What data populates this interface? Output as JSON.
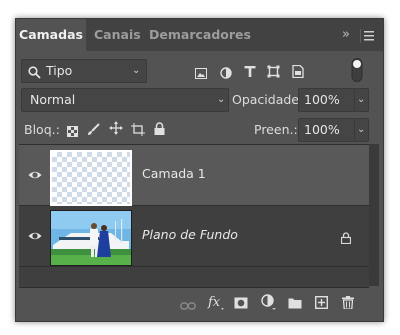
{
  "tabs": [
    {
      "label": "Camadas",
      "active": true
    },
    {
      "label": "Canais",
      "active": false
    },
    {
      "label": "Demarcadores",
      "active": false
    }
  ],
  "tab_overflow": "»",
  "filter": {
    "label": "Tipo"
  },
  "blend": {
    "mode": "Normal",
    "opacity_label": "Opacidade:",
    "opacity_value": "100%"
  },
  "lock": {
    "label": "Bloq.:",
    "fill_label": "Preen.:",
    "fill_value": "100%"
  },
  "layers": [
    {
      "name": "Camada 1",
      "selected": true,
      "visible": true,
      "italic": false,
      "locked": false
    },
    {
      "name": "Plano de Fundo",
      "selected": false,
      "visible": true,
      "italic": true,
      "locked": true
    }
  ],
  "colors": {
    "panel": "#535353",
    "tabbar": "#424242",
    "selected_layer": "#595959",
    "list_bg": "#3f3f3f"
  }
}
